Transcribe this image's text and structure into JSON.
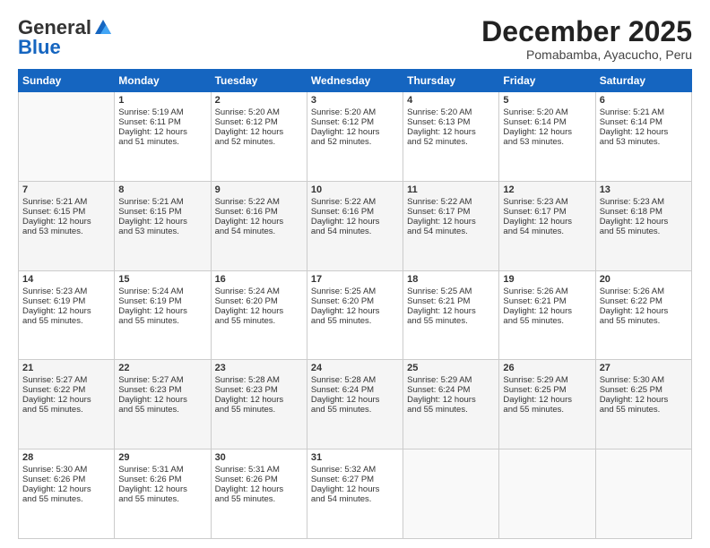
{
  "logo": {
    "general": "General",
    "blue": "Blue"
  },
  "title": "December 2025",
  "location": "Pomabamba, Ayacucho, Peru",
  "days": [
    "Sunday",
    "Monday",
    "Tuesday",
    "Wednesday",
    "Thursday",
    "Friday",
    "Saturday"
  ],
  "weeks": [
    [
      {
        "num": "",
        "info": ""
      },
      {
        "num": "1",
        "info": "Sunrise: 5:19 AM\nSunset: 6:11 PM\nDaylight: 12 hours\nand 51 minutes."
      },
      {
        "num": "2",
        "info": "Sunrise: 5:20 AM\nSunset: 6:12 PM\nDaylight: 12 hours\nand 52 minutes."
      },
      {
        "num": "3",
        "info": "Sunrise: 5:20 AM\nSunset: 6:12 PM\nDaylight: 12 hours\nand 52 minutes."
      },
      {
        "num": "4",
        "info": "Sunrise: 5:20 AM\nSunset: 6:13 PM\nDaylight: 12 hours\nand 52 minutes."
      },
      {
        "num": "5",
        "info": "Sunrise: 5:20 AM\nSunset: 6:14 PM\nDaylight: 12 hours\nand 53 minutes."
      },
      {
        "num": "6",
        "info": "Sunrise: 5:21 AM\nSunset: 6:14 PM\nDaylight: 12 hours\nand 53 minutes."
      }
    ],
    [
      {
        "num": "7",
        "info": "Sunrise: 5:21 AM\nSunset: 6:15 PM\nDaylight: 12 hours\nand 53 minutes."
      },
      {
        "num": "8",
        "info": "Sunrise: 5:21 AM\nSunset: 6:15 PM\nDaylight: 12 hours\nand 53 minutes."
      },
      {
        "num": "9",
        "info": "Sunrise: 5:22 AM\nSunset: 6:16 PM\nDaylight: 12 hours\nand 54 minutes."
      },
      {
        "num": "10",
        "info": "Sunrise: 5:22 AM\nSunset: 6:16 PM\nDaylight: 12 hours\nand 54 minutes."
      },
      {
        "num": "11",
        "info": "Sunrise: 5:22 AM\nSunset: 6:17 PM\nDaylight: 12 hours\nand 54 minutes."
      },
      {
        "num": "12",
        "info": "Sunrise: 5:23 AM\nSunset: 6:17 PM\nDaylight: 12 hours\nand 54 minutes."
      },
      {
        "num": "13",
        "info": "Sunrise: 5:23 AM\nSunset: 6:18 PM\nDaylight: 12 hours\nand 55 minutes."
      }
    ],
    [
      {
        "num": "14",
        "info": "Sunrise: 5:23 AM\nSunset: 6:19 PM\nDaylight: 12 hours\nand 55 minutes."
      },
      {
        "num": "15",
        "info": "Sunrise: 5:24 AM\nSunset: 6:19 PM\nDaylight: 12 hours\nand 55 minutes."
      },
      {
        "num": "16",
        "info": "Sunrise: 5:24 AM\nSunset: 6:20 PM\nDaylight: 12 hours\nand 55 minutes."
      },
      {
        "num": "17",
        "info": "Sunrise: 5:25 AM\nSunset: 6:20 PM\nDaylight: 12 hours\nand 55 minutes."
      },
      {
        "num": "18",
        "info": "Sunrise: 5:25 AM\nSunset: 6:21 PM\nDaylight: 12 hours\nand 55 minutes."
      },
      {
        "num": "19",
        "info": "Sunrise: 5:26 AM\nSunset: 6:21 PM\nDaylight: 12 hours\nand 55 minutes."
      },
      {
        "num": "20",
        "info": "Sunrise: 5:26 AM\nSunset: 6:22 PM\nDaylight: 12 hours\nand 55 minutes."
      }
    ],
    [
      {
        "num": "21",
        "info": "Sunrise: 5:27 AM\nSunset: 6:22 PM\nDaylight: 12 hours\nand 55 minutes."
      },
      {
        "num": "22",
        "info": "Sunrise: 5:27 AM\nSunset: 6:23 PM\nDaylight: 12 hours\nand 55 minutes."
      },
      {
        "num": "23",
        "info": "Sunrise: 5:28 AM\nSunset: 6:23 PM\nDaylight: 12 hours\nand 55 minutes."
      },
      {
        "num": "24",
        "info": "Sunrise: 5:28 AM\nSunset: 6:24 PM\nDaylight: 12 hours\nand 55 minutes."
      },
      {
        "num": "25",
        "info": "Sunrise: 5:29 AM\nSunset: 6:24 PM\nDaylight: 12 hours\nand 55 minutes."
      },
      {
        "num": "26",
        "info": "Sunrise: 5:29 AM\nSunset: 6:25 PM\nDaylight: 12 hours\nand 55 minutes."
      },
      {
        "num": "27",
        "info": "Sunrise: 5:30 AM\nSunset: 6:25 PM\nDaylight: 12 hours\nand 55 minutes."
      }
    ],
    [
      {
        "num": "28",
        "info": "Sunrise: 5:30 AM\nSunset: 6:26 PM\nDaylight: 12 hours\nand 55 minutes."
      },
      {
        "num": "29",
        "info": "Sunrise: 5:31 AM\nSunset: 6:26 PM\nDaylight: 12 hours\nand 55 minutes."
      },
      {
        "num": "30",
        "info": "Sunrise: 5:31 AM\nSunset: 6:26 PM\nDaylight: 12 hours\nand 55 minutes."
      },
      {
        "num": "31",
        "info": "Sunrise: 5:32 AM\nSunset: 6:27 PM\nDaylight: 12 hours\nand 54 minutes."
      },
      {
        "num": "",
        "info": ""
      },
      {
        "num": "",
        "info": ""
      },
      {
        "num": "",
        "info": ""
      }
    ]
  ]
}
